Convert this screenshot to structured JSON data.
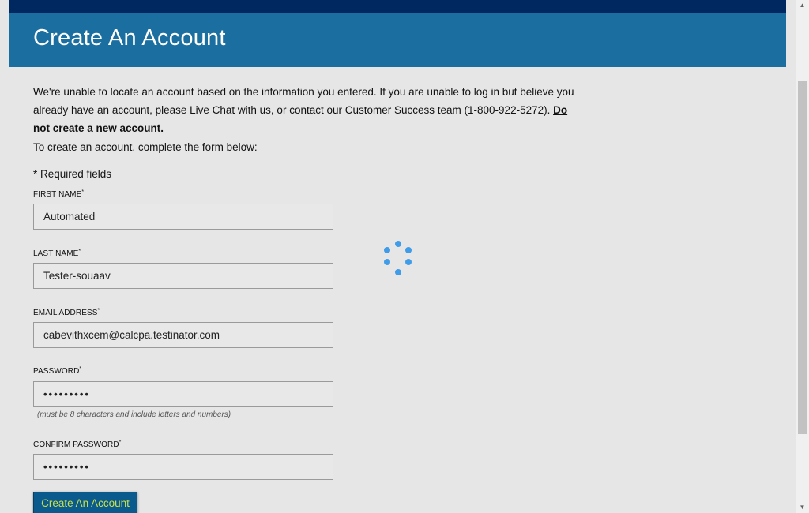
{
  "header": {
    "title": "Create An Account"
  },
  "notice": {
    "text": "We're unable to locate an account based on the information you entered. If you are unable to log in but believe you already have an account, please Live Chat with us, or contact our Customer Success team (1-800-922-5272). ",
    "emphasis": "Do not create a new account."
  },
  "instructions": "To create an account, complete the form below:",
  "required_note": "* Required fields",
  "form": {
    "first_name": {
      "label": "FIRST NAME",
      "value": "Automated"
    },
    "last_name": {
      "label": "LAST NAME",
      "value": "Tester-souaav"
    },
    "email": {
      "label": "EMAIL ADDRESS",
      "value": "cabevithxcem@calcpa.testinator.com"
    },
    "password": {
      "label": "PASSWORD",
      "value": "•••••••••",
      "hint": "(must be 8 characters and include letters and numbers)"
    },
    "confirm_password": {
      "label": "CONFIRM PASSWORD",
      "value": "•••••••••"
    },
    "required_marker": "*",
    "submit_label": "Create An Account"
  },
  "colors": {
    "top_bar": "#002860",
    "banner": "#1a6ea0",
    "button_bg": "#0a5a8e",
    "button_text": "#c8e04a",
    "spinner": "#3f9ce8"
  },
  "icons": {
    "spinner": "loading-spinner-icon",
    "scroll_up": "scroll-up-arrow-icon",
    "scroll_down": "scroll-down-arrow-icon"
  }
}
